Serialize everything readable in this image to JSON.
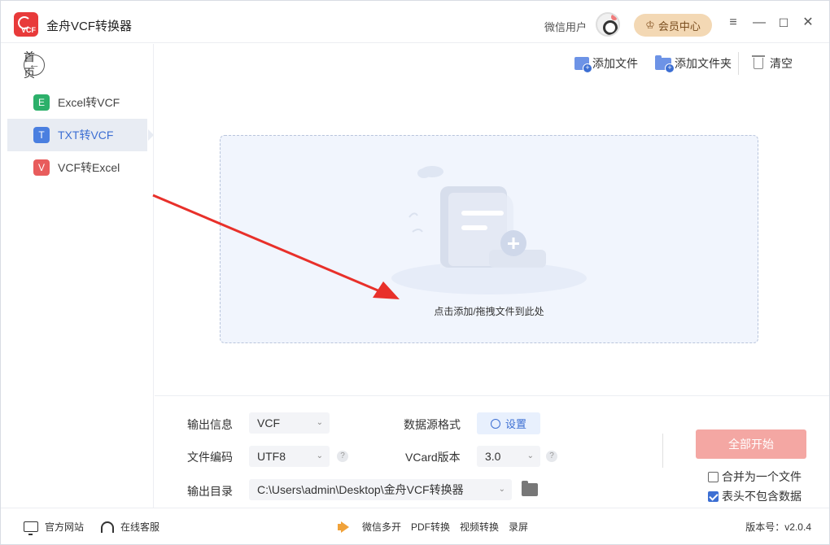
{
  "app": {
    "title": "金舟VCF转换器",
    "logo_text": "VCF",
    "user_name": "微信用户",
    "vip_label": "会员中心",
    "controls": [
      "≡",
      "—",
      "☐",
      "✕"
    ]
  },
  "sidebar": {
    "home_label": "首页",
    "items": [
      {
        "label": "Excel转VCF",
        "badge": "E",
        "badge_color": "#2cb06a",
        "active": false
      },
      {
        "label": "TXT转VCF",
        "badge": "T",
        "badge_color": "#4a7fe0",
        "active": true
      },
      {
        "label": "VCF转Excel",
        "badge": "V",
        "badge_color": "#e85c5c",
        "active": false
      }
    ]
  },
  "toolbar": {
    "add_file": "添加文件",
    "add_folder": "添加文件夹",
    "clear": "清空"
  },
  "dropzone": {
    "hint": "点击添加/拖拽文件到此处"
  },
  "settings": {
    "output_info_label": "输出信息",
    "output_info_value": "VCF",
    "encoding_label": "文件编码",
    "encoding_value": "UTF8",
    "output_dir_label": "输出目录",
    "output_dir_value": "C:\\Users\\admin\\Desktop\\金舟VCF转换器",
    "source_format_label": "数据源格式",
    "settings_btn": "设置",
    "vcard_label": "VCard版本",
    "vcard_value": "3.0",
    "help_glyph": "?",
    "start_btn": "全部开始",
    "merge_label": "合并为一个文件",
    "merge_checked": false,
    "header_label": "表头不包含数据",
    "header_checked": true
  },
  "statusbar": {
    "website": "官方网站",
    "support": "在线客服",
    "wechat_multi": "微信多开",
    "pdf": "PDF转换",
    "video": "视频转换",
    "record": "录屏",
    "version": "版本号：v2.0.4"
  },
  "colors": {
    "accent": "#3d6fd3",
    "start_button": "#f4a7a3",
    "vip_bg": "#f3d8b4",
    "arrow": "#e8302a"
  }
}
